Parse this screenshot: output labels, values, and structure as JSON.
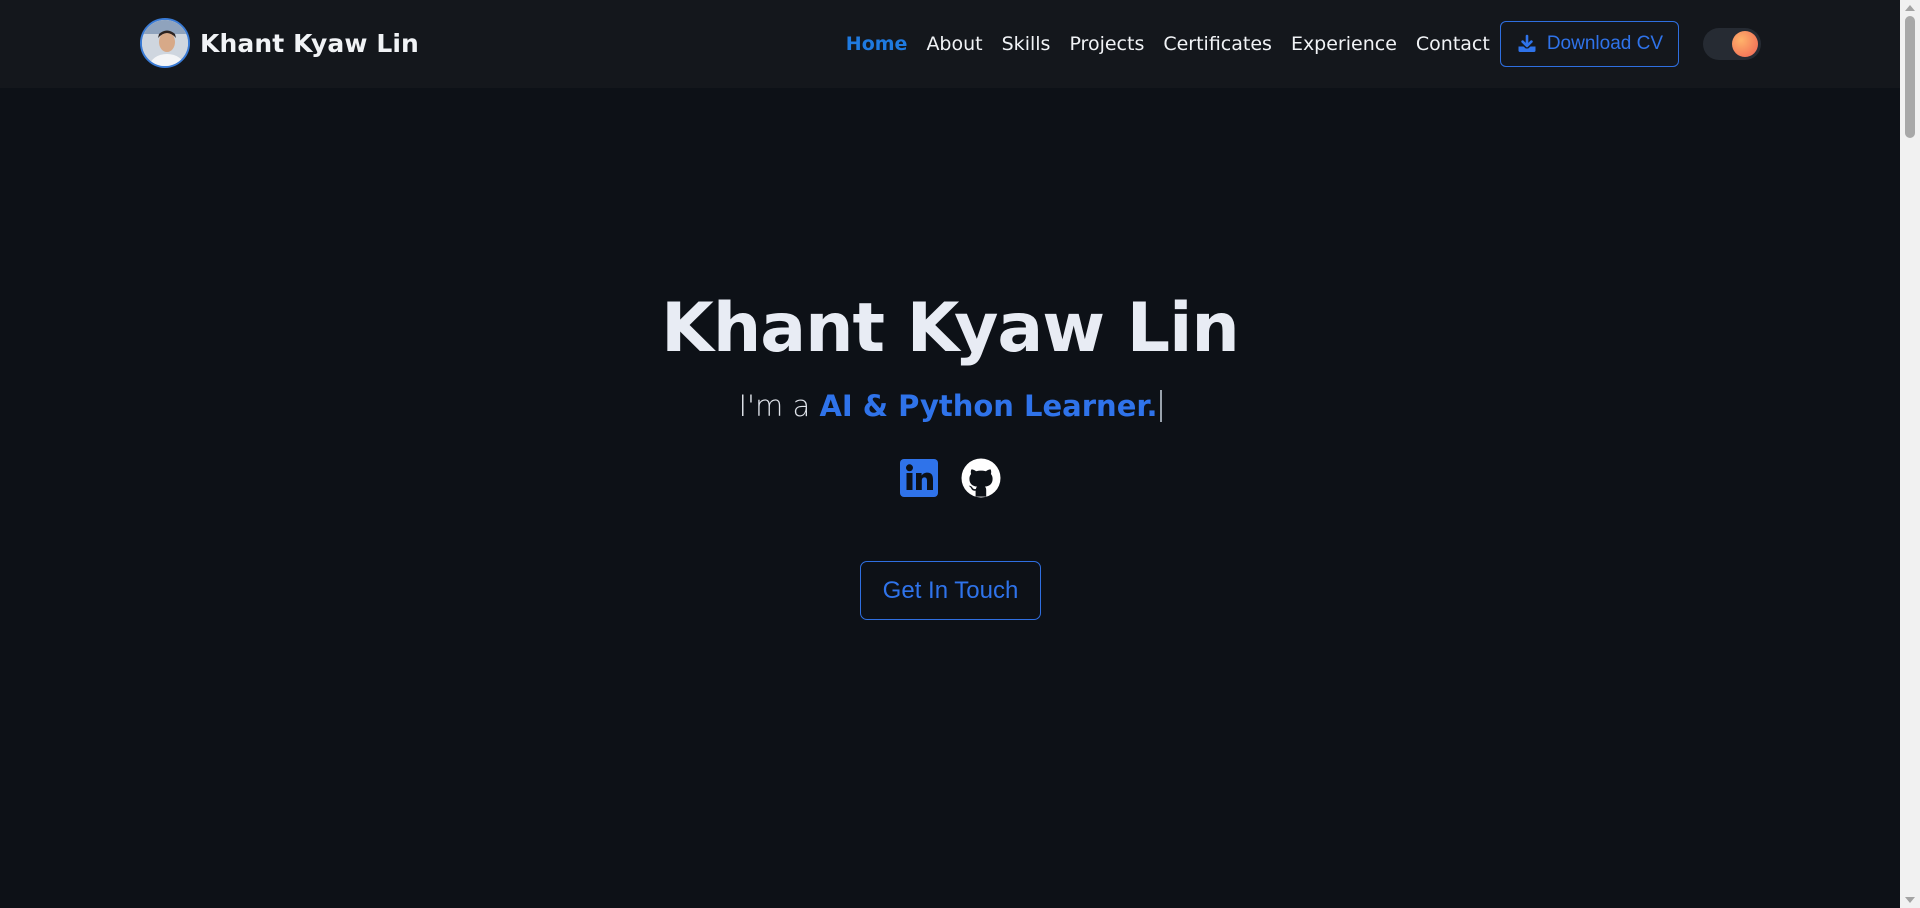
{
  "navbar": {
    "brand_name": "Khant Kyaw Lin",
    "links": [
      {
        "label": "Home",
        "active": true
      },
      {
        "label": "About"
      },
      {
        "label": "Skills"
      },
      {
        "label": "Projects"
      },
      {
        "label": "Certificates"
      },
      {
        "label": "Experience"
      },
      {
        "label": "Contact"
      }
    ],
    "download_cv_label": "Download CV",
    "download_icon": "download-icon",
    "theme_toggle_icon": "theme-toggle"
  },
  "hero": {
    "title": "Khant Kyaw Lin",
    "subtitle_prefix": "I'm a ",
    "subtitle_role": "AI & Python Learner.",
    "socials": [
      {
        "name": "linkedin-icon"
      },
      {
        "name": "github-icon"
      }
    ],
    "cta_label": "Get In Touch"
  },
  "colors": {
    "background": "#0d1117",
    "navbar": "#14171c",
    "accent": "#2f73ea",
    "active_link": "#1f7ae0",
    "text": "#f1f3f6"
  }
}
